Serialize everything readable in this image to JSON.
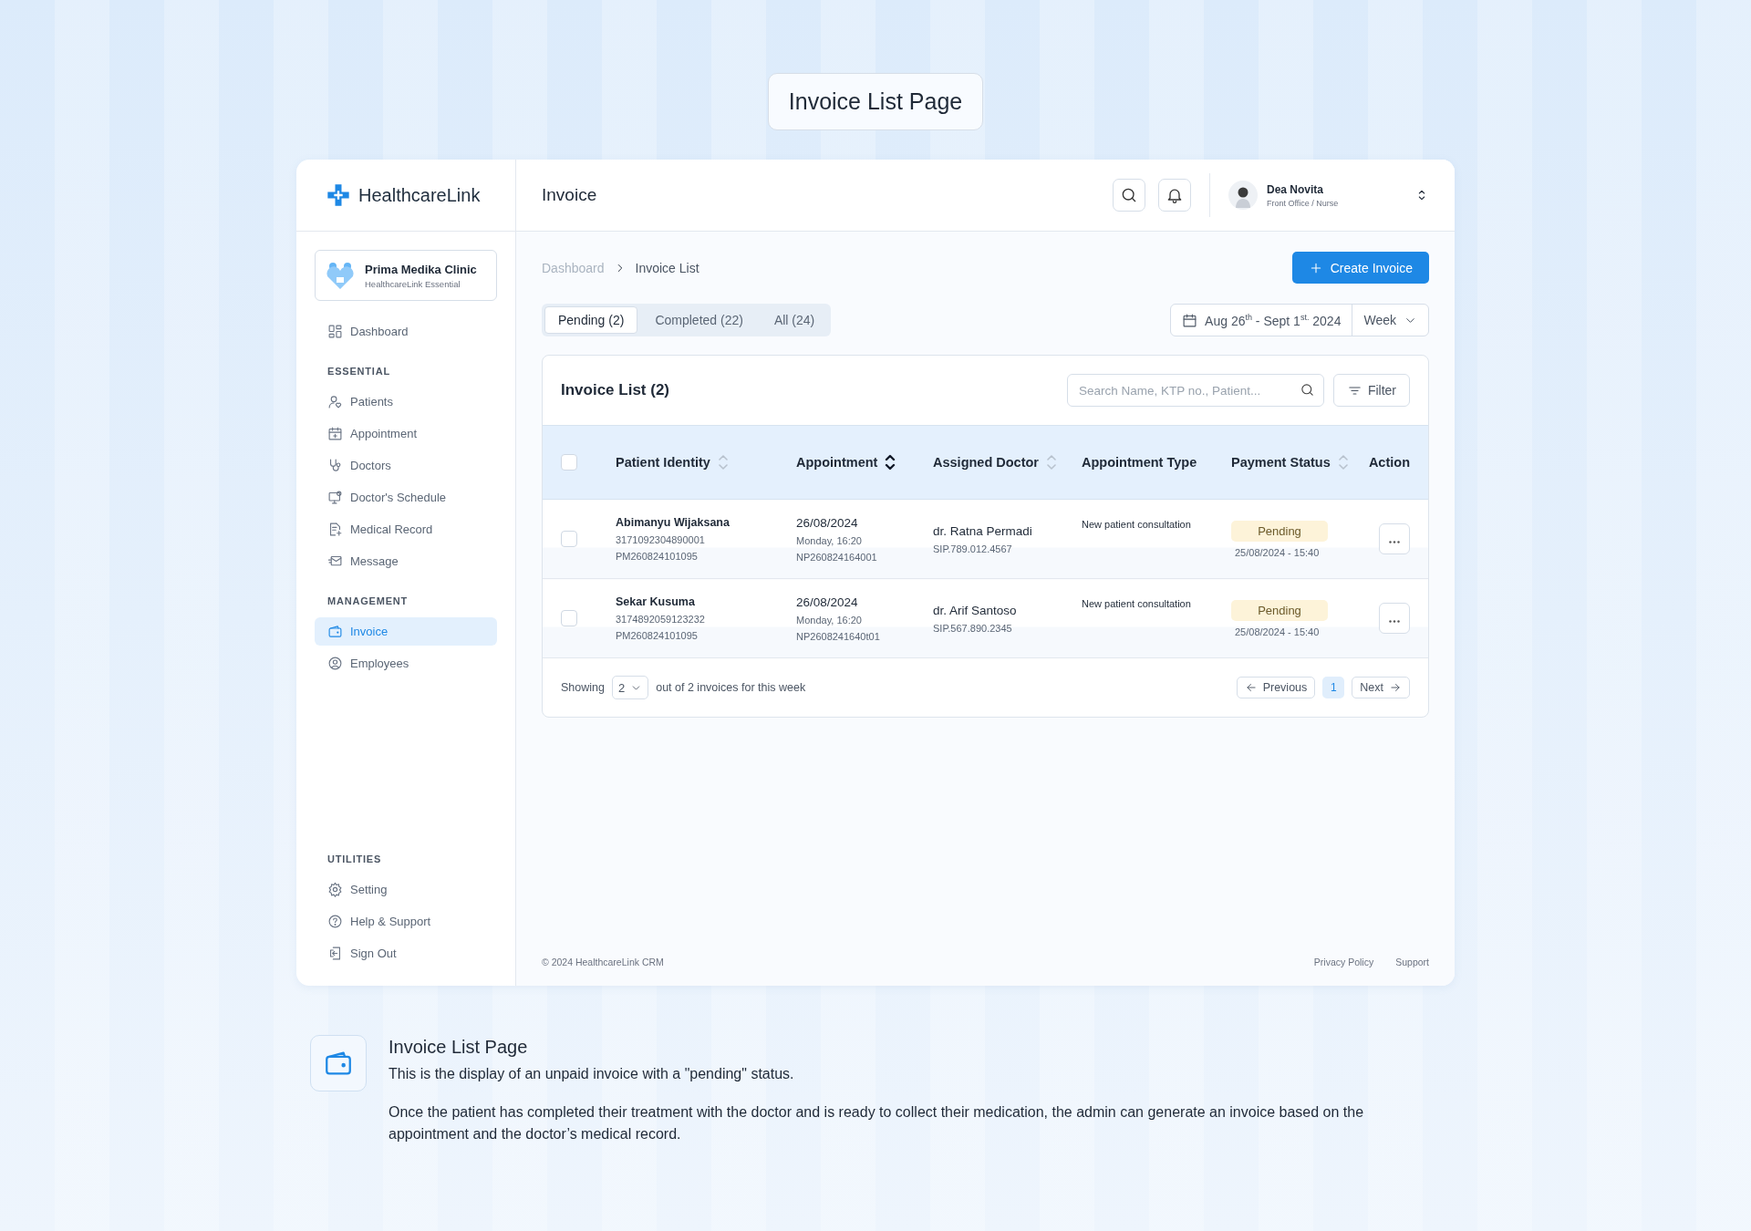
{
  "page_title": "Invoice List Page",
  "brand": "HealthcareLink",
  "clinic": {
    "name": "Prima Medika Clinic",
    "plan": "HealthcareLink Essential"
  },
  "sidebar": [
    {
      "items": [
        {
          "label": "Dashboard",
          "selected": false
        }
      ]
    },
    {
      "heading": "ESSENTIAL",
      "items": [
        {
          "label": "Patients",
          "selected": false
        },
        {
          "label": "Appointment",
          "selected": false
        },
        {
          "label": "Doctors",
          "selected": false
        },
        {
          "label": "Doctor's Schedule",
          "selected": false
        },
        {
          "label": "Medical Record",
          "selected": false
        },
        {
          "label": "Message",
          "selected": false
        }
      ]
    },
    {
      "heading": "MANAGEMENT",
      "items": [
        {
          "label": "Invoice",
          "selected": true
        },
        {
          "label": "Employees",
          "selected": false
        }
      ]
    },
    {
      "heading": "UTILITIES",
      "items": [
        {
          "label": "Setting",
          "selected": false
        },
        {
          "label": "Help & Support",
          "selected": false
        },
        {
          "label": "Sign Out",
          "selected": false
        }
      ]
    }
  ],
  "header": {
    "title": "Invoice",
    "user": {
      "name": "Dea Novita",
      "role": "Front Office / Nurse"
    }
  },
  "breadcrumb": [
    "Dashboard",
    "Invoice List"
  ],
  "create_button": "Create Invoice",
  "tabs": [
    {
      "label": "Pending (2)",
      "selected": true
    },
    {
      "label": "Completed (22)",
      "selected": false
    },
    {
      "label": "All (24)",
      "selected": false
    }
  ],
  "date_range": "Aug 26$^{th}$ - Sept 1$^{st.}$ 2024",
  "period": "Week",
  "table": {
    "title": "Invoice List (2)",
    "search": {
      "placeholder": "Search Name, KTP no., Patient..."
    },
    "filter": "Filter",
    "select_all": {
      "checked": false
    },
    "columns": [
      {
        "label": "Patient Identity",
        "sortable": true,
        "sorted": false
      },
      {
        "label": "Appointment",
        "sortable": true,
        "sorted": true
      },
      {
        "label": "Assigned Doctor",
        "sortable": true,
        "sorted": false
      },
      {
        "label": "Appointment Type",
        "sortable": false,
        "sorted": false
      },
      {
        "label": "Payment Status",
        "sortable": true,
        "sorted": false
      },
      {
        "label": "Action",
        "sortable": false,
        "sorted": false
      }
    ],
    "rows": [
      {
        "checked": false,
        "patient": {
          "name": "Abimanyu Wijaksana",
          "nik": "3171092304890001",
          "id": "PM260824101095"
        },
        "appointment": {
          "date": "26/08/2024",
          "time": "Monday, 16:20",
          "id": "NP260824164001"
        },
        "doctor": {
          "name": "dr. Ratna Permadi",
          "sip": "SIP.789.012.4567"
        },
        "type": "New patient consultation",
        "status": {
          "label": "Pending",
          "date": "25/08/2024 - 15:40"
        }
      },
      {
        "checked": false,
        "patient": {
          "name": "Sekar Kusuma",
          "nik": "3174892059123232",
          "id": "PM260824101095"
        },
        "appointment": {
          "date": "26/08/2024",
          "time": "Monday, 16:20",
          "id": "NP2608241640t01"
        },
        "doctor": {
          "name": "dr. Arif Santoso",
          "sip": "SIP.567.890.2345"
        },
        "type": "New patient consultation",
        "status": {
          "label": "Pending",
          "date": "25/08/2024 - 15:40"
        }
      }
    ],
    "footer": {
      "showing": "Showing",
      "page_size": "2",
      "summary": "out of 2 invoices for this week",
      "previous": "Previous",
      "pages": [
        {
          "label": "1",
          "selected": true
        }
      ],
      "next": "Next"
    }
  },
  "app_footer": {
    "copyright": "© 2024 HealthcareLink CRM",
    "links": [
      "Privacy Policy",
      "Support"
    ]
  },
  "description": {
    "title": "Invoice List Page",
    "paragraphs": [
      "This is the display of an unpaid invoice with a \"pending\" status.",
      "Once the patient has completed their treatment with the doctor and is ready to collect their medication, the admin can generate an invoice based on the appointment and the doctor’s medical record."
    ]
  }
}
